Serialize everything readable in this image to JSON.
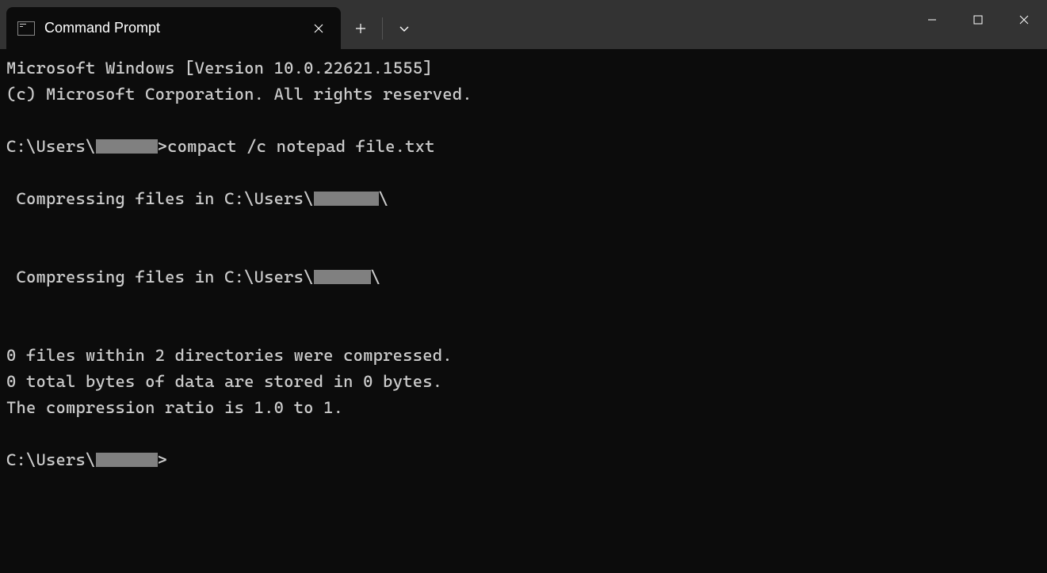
{
  "tab": {
    "title": "Command Prompt"
  },
  "terminal": {
    "banner_line1": "Microsoft Windows [Version 10.0.22621.1555]",
    "banner_line2": "(c) Microsoft Corporation. All rights reserved.",
    "prompt_prefix": "C:\\Users\\",
    "prompt_suffix": ">",
    "command": "compact /c notepad file.txt",
    "compressing_prefix": " Compressing files in C:\\Users\\",
    "compressing_suffix": "\\",
    "summary_line1": "0 files within 2 directories were compressed.",
    "summary_line2": "0 total bytes of data are stored in 0 bytes.",
    "summary_line3": "The compression ratio is 1.0 to 1."
  }
}
